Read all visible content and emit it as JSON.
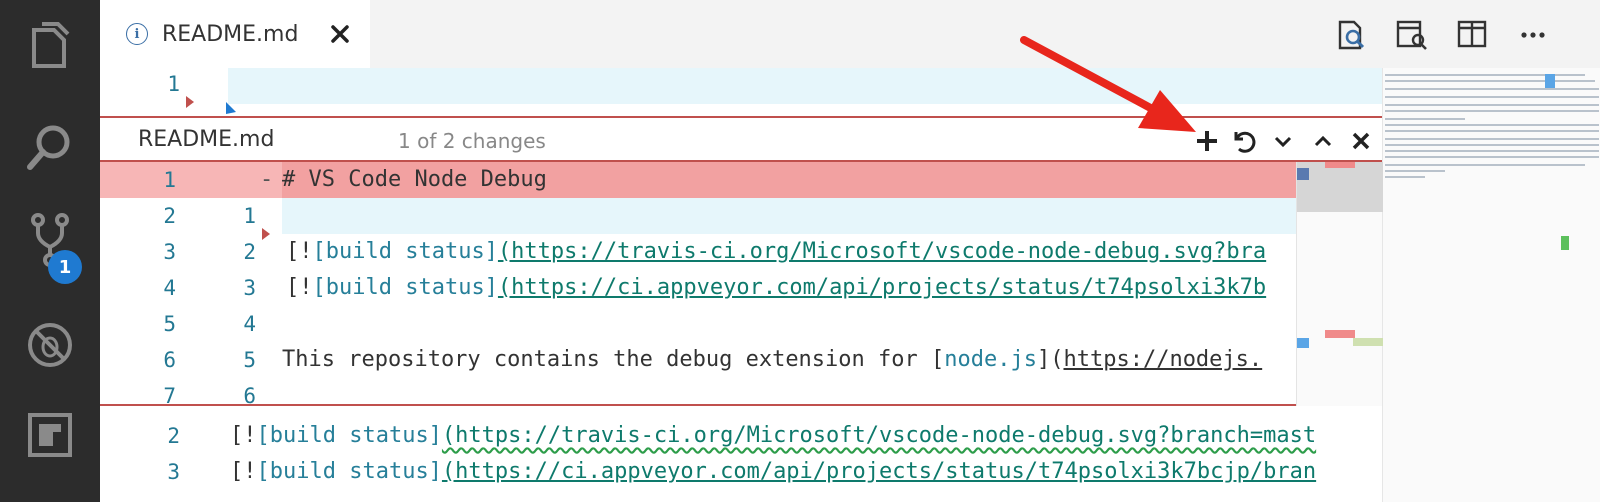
{
  "activity_bar": {
    "items": [
      "explorer-icon",
      "search-icon",
      "source-control-icon",
      "debug-icon",
      "extensions-icon"
    ],
    "scm_badge": "1"
  },
  "tab": {
    "title": "README.md",
    "info_icon": "i"
  },
  "top_actions": [
    "open-changes-icon",
    "open-preview-icon",
    "split-editor-icon",
    "more-actions-icon"
  ],
  "editor": {
    "line_1_number": "1",
    "lines_below": [
      {
        "num": "2",
        "prefix": "[!",
        "link_text": "[build status]",
        "url": "(https://travis-ci.org/Microsoft/vscode-node-debug.svg?branch=mast"
      },
      {
        "num": "3",
        "prefix": "[!",
        "link_text": "[build status]",
        "url": "(https://ci.appveyor.com/api/projects/status/t74psolxi3k7bcjp/bran"
      }
    ]
  },
  "peek": {
    "title": "README.md",
    "subtitle": "1 of 2 changes",
    "actions": [
      "stage-change-icon",
      "revert-change-icon",
      "next-change-icon",
      "previous-change-icon",
      "close-icon"
    ],
    "rows": [
      {
        "orig": "1",
        "mod": "",
        "sign": "-",
        "text": "# VS Code Node Debug",
        "kind": "deleted"
      },
      {
        "orig": "2",
        "mod": "1",
        "sign": "",
        "text": "",
        "kind": "inserted"
      },
      {
        "orig": "3",
        "mod": "2",
        "prefix": "[!",
        "link_text": "[build status]",
        "url": "(https://travis-ci.org/Microsoft/vscode-node-debug.svg?bra"
      },
      {
        "orig": "4",
        "mod": "3",
        "prefix": "[!",
        "link_text": "[build status]",
        "url": "(https://ci.appveyor.com/api/projects/status/t74psolxi3k7b"
      },
      {
        "orig": "5",
        "mod": "4",
        "text": ""
      },
      {
        "orig": "6",
        "mod": "5",
        "text": "This repository contains the debug extension for [",
        "link_text": "node.js",
        "close": "](",
        "url": "https://nodejs."
      },
      {
        "orig": "7",
        "mod": "6",
        "text": ""
      }
    ]
  },
  "colors": {
    "accent_red": "#c0504d",
    "arrow_red": "#e8261c",
    "deleted_bg": "#f2a1a1",
    "inserted_bg": "#e6f6fb"
  }
}
